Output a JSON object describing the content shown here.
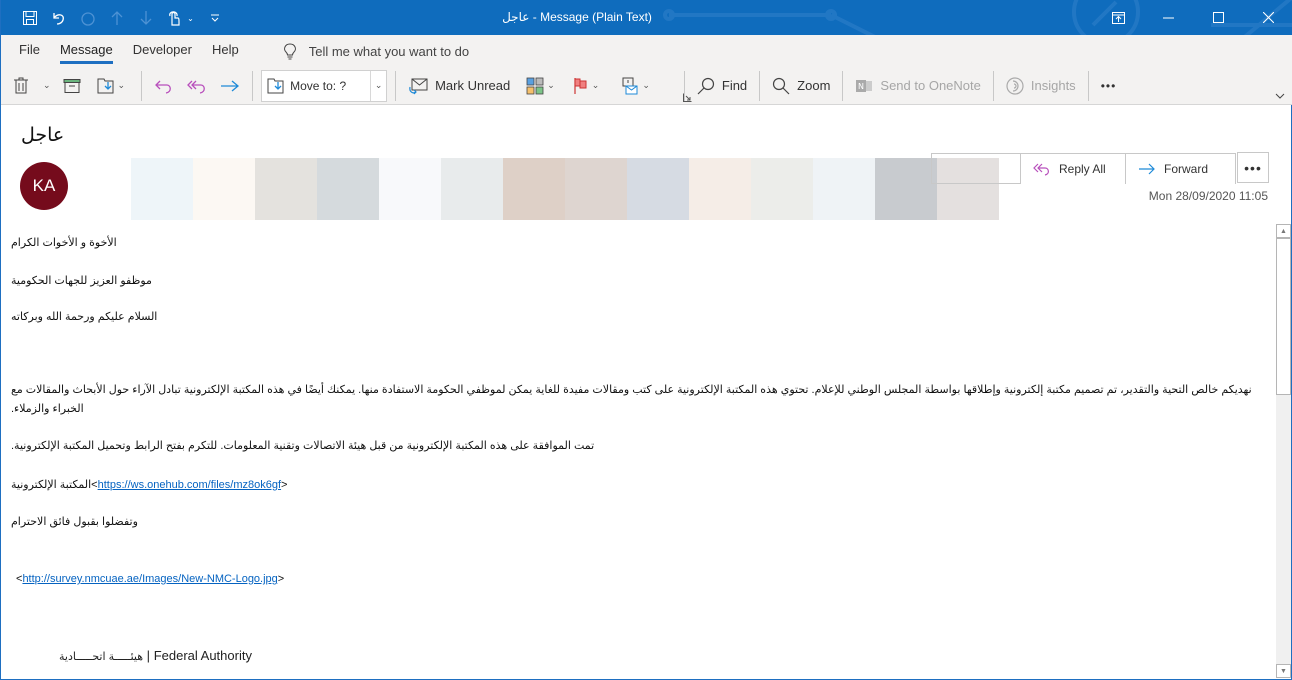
{
  "window": {
    "title": "عاجل  -  Message (Plain Text)",
    "accent": "#0f6cbd"
  },
  "quick_access": [
    {
      "icon": "save-icon",
      "enabled": true
    },
    {
      "icon": "undo-icon",
      "enabled": true
    },
    {
      "icon": "redo-icon",
      "enabled": false
    },
    {
      "icon": "up-arrow-icon",
      "enabled": false
    },
    {
      "icon": "down-arrow-icon",
      "enabled": false
    },
    {
      "icon": "touch-mode-icon",
      "enabled": true
    },
    {
      "icon": "customize-qat-icon",
      "enabled": true
    }
  ],
  "menu": {
    "tabs": [
      {
        "label": "File",
        "active": false
      },
      {
        "label": "Message",
        "active": true
      },
      {
        "label": "Developer",
        "active": false
      },
      {
        "label": "Help",
        "active": false
      }
    ],
    "tell_me": "Tell me what you want to do"
  },
  "ribbon": {
    "move_to_label": "Move to: ?",
    "mark_unread": "Mark Unread",
    "find": "Find",
    "zoom": "Zoom",
    "send_onenote": "Send to OneNote",
    "insights": "Insights",
    "more": "•••"
  },
  "message": {
    "subject": "عاجل",
    "sender_initials": "KA",
    "avatar_color": "#750b1c",
    "banner_colors": [
      "#eef5f9",
      "#fcf8f3",
      "#e4e2de",
      "#d5dadd",
      "#f8f9fb",
      "#e8ebec",
      "#ded0c7",
      "#ded5d0",
      "#d6dbe3",
      "#f5ede7",
      "#ecedea",
      "#eff3f6",
      "#c8cbcf",
      "#e4e0df"
    ],
    "actions": {
      "reply_all": "Reply All",
      "forward": "Forward",
      "more": "•••"
    },
    "date": "Mon 28/09/2020 11:05"
  },
  "body": {
    "line1": "الأخوة و الأخوات الكرام",
    "line2": "موظفو العزيز للجهات الحكومية",
    "line3": "السلام عليكم ورحمة الله وبركاته",
    "para1": "نهديكم خالص التحية والتقدير، تم تصميم مكتبة إلكترونية وإطلاقها بواسطة المجلس الوطني للإعلام. تحتوي هذه المكتبة الإلكترونية على كتب ومقالات مفيدة للغاية يمكن لموظفي الحكومة الاستفادة منها. يمكنك أيضًا في هذه المكتبة الإلكترونية تبادل الآراء حول الأبحاث والمقالات مع الخبراء والزملاء.",
    "para2": "تمت الموافقة على هذه المكتبة الإلكترونية من قبل هيئة الاتصالات وتقنية المعلومات. للتكرم بفتح الرابط وتحميل المكتبة الإلكترونية.",
    "library_label": "المكتبة الإلكترونية",
    "library_link": "https://ws.onehub.com/files/mz8ok6gf",
    "closing": "وتفضلوا بقبول فائق الاحترام",
    "logo_link": "http://survey.nmcuae.ae/Images/New-NMC-Logo.jpg",
    "signature_ar": "هيئـــــة اتحـــــادية",
    "signature_sep": "|",
    "signature_en": "Federal Authority"
  }
}
